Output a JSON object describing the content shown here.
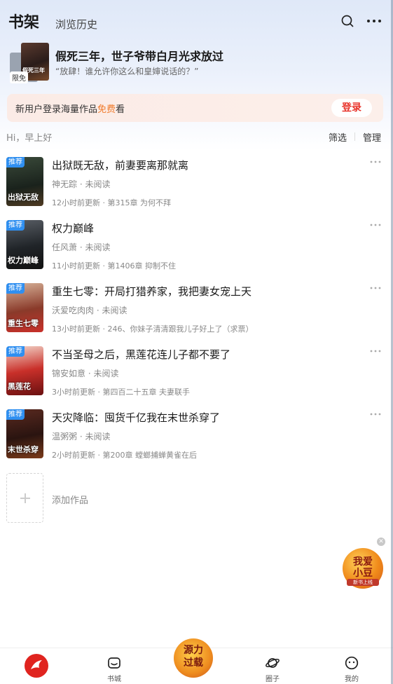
{
  "header": {
    "title": "书架",
    "history_tab": "浏览历史"
  },
  "featured": {
    "title": "假死三年，世子爷带白月光求放过",
    "quote": "“放肆！谁允许你这么和皇婶说话的？”",
    "badge": "限免",
    "cover_text": "假死三年"
  },
  "login_banner": {
    "text_before": "新用户登录海量作品",
    "text_free": "免费",
    "text_after": "看",
    "button": "登录"
  },
  "toolbar": {
    "greeting": "Hi，早上好",
    "filter": "筛选",
    "manage": "管理"
  },
  "books": [
    {
      "badge": "推荐",
      "title": "出狱既无敌，前妻要离那就离",
      "author": "神无踪 · 未阅读",
      "update": "12小时前更新 · 第315章 为何不拜",
      "cover_text": "出狱无敌"
    },
    {
      "badge": "推荐",
      "title": "权力巅峰",
      "author": "任风萧 · 未阅读",
      "update": "11小时前更新 · 第1406章 抑制不住",
      "cover_text": "权力巅峰"
    },
    {
      "badge": "推荐",
      "title": "重生七零：开局打猎养家，我把妻女宠上天",
      "author": "沃爱吃肉肉 · 未阅读",
      "update": "13小时前更新 · 246、你妹子清清跟我儿子好上了（求票）",
      "cover_text": "重生七零"
    },
    {
      "badge": "推荐",
      "title": "不当圣母之后，黑莲花连儿子都不要了",
      "author": "锦安如意 · 未阅读",
      "update": "3小时前更新 · 第四百二十五章 夫妻联手",
      "cover_text": "黑莲花"
    },
    {
      "badge": "推荐",
      "title": "天灾降临：囤货千亿我在末世杀穿了",
      "author": "温粥粥 · 未阅读",
      "update": "2小时前更新 · 第200章 螳螂捕蝉黄雀在后",
      "cover_text": "末世杀穿"
    }
  ],
  "add_work": "添加作品",
  "float_promo": {
    "line1": "我爱",
    "line2": "小豆",
    "line3": "新书上线"
  },
  "bottom_nav": {
    "store": "书城",
    "center_line1": "源力",
    "center_line2": "过载",
    "circle": "圈子",
    "mine": "我的"
  },
  "colors": {
    "accent_red": "#e8332a",
    "free_orange": "#f07a2a",
    "badge_blue": "#2f8ff0"
  }
}
